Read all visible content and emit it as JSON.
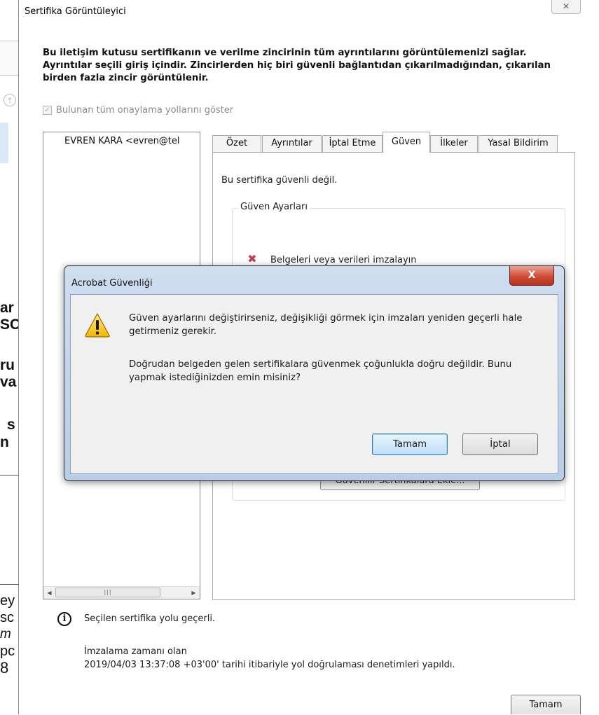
{
  "background_fragments": {
    "line1": "ar",
    "line2": "SC",
    "line3": "ru",
    "line4": "va",
    "line5": "s",
    "line6": "n",
    "line7": "ey",
    "line8": "sc",
    "line9": "m",
    "line10": "pc",
    "line11": "8"
  },
  "cert_viewer": {
    "title": "Sertifika Görüntüleyici",
    "close_glyph": "✕",
    "description": "Bu iletişim kutusu sertifikanın ve verilme zincirinin tüm ayrıntılarını görüntülemenizi sağlar. Ayrıntılar seçili giriş içindir. Zincirlerden hiç biri güvenli bağlantıdan çıkarılmadığından, çıkarılan birden fazla zincir görüntülenir.",
    "show_all_paths_label": "Bulunan tüm onaylama yollarını göster",
    "show_all_paths_checked": true,
    "chain_items": [
      "EVREN KARA <evren@tel"
    ],
    "tabs": [
      "Özet",
      "Ayrıntılar",
      "İptal Etme",
      "Güven",
      "İlkeler",
      "Yasal Bildirim"
    ],
    "active_tab": "Güven",
    "trust_status": "Bu sertifika güvenli değil.",
    "trust_settings_legend": "Güven Ayarları",
    "trust_settings_items": [
      "Belgeleri veya verileri imzalayın"
    ],
    "add_trusted_button": "Güvenilir Sertifikalara Ekle...",
    "path_status": "Seçilen sertifika yolu geçerli.",
    "signing_time_line1": "İmzalama zamanı olan",
    "signing_time_line2": "2019/04/03 13:37:08 +03'00' tarihi itibariyle yol doğrulaması denetimleri yapıldı.",
    "ok_button": "Tamam"
  },
  "acrobat_dialog": {
    "title": "Acrobat Güvenliği",
    "close_glyph": "X",
    "message1": "Güven ayarlarını değiştirirseniz, değişikliği görmek için imzaları yeniden geçerli hale getirmeniz gerekir.",
    "message2": "Doğrudan belgeden gelen sertifikalara güvenmek çoğunlukla doğru değildir. Bunu yapmak istediğinizden emin misiniz?",
    "ok_button": "Tamam",
    "cancel_button": "İptal",
    "icon": "warning-icon"
  },
  "colors": {
    "modal_frame": "#b9cde5",
    "modal_close": "#cf4b35",
    "primary_button": "#bfe0f7",
    "deny_mark": "#c43a55"
  }
}
